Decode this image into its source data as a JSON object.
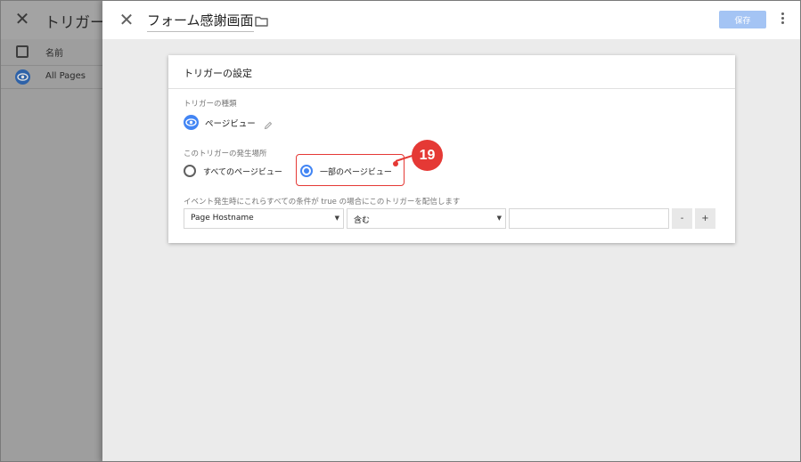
{
  "background_panel": {
    "title": "トリガーの",
    "column_name": "名前",
    "rows": [
      {
        "label": "All Pages"
      }
    ]
  },
  "sheet": {
    "title": "フォーム感謝画面",
    "save_label": "保存"
  },
  "card": {
    "title": "トリガーの設定",
    "type_label": "トリガーの種類",
    "type_value": "ページビュー",
    "fires_on_label": "このトリガーの発生場所",
    "options": [
      {
        "label": "すべてのページビュー",
        "selected": false
      },
      {
        "label": "一部のページビュー",
        "selected": true
      }
    ],
    "condition_label": "イベント発生時にこれらすべての条件が true の場合にこのトリガーを配信します",
    "condition": {
      "variable": "Page Hostname",
      "operator": "含む",
      "value": "",
      "remove_label": "-",
      "add_label": "+"
    }
  },
  "annotation": {
    "number": "19"
  },
  "colors": {
    "accent": "#4285f4",
    "save_button": "#a4c4f4",
    "annotation": "#e53935"
  },
  "icons": [
    "close-icon",
    "eye-icon",
    "folder-icon",
    "more-vert-icon",
    "pencil-icon",
    "dropdown-arrow-icon"
  ]
}
